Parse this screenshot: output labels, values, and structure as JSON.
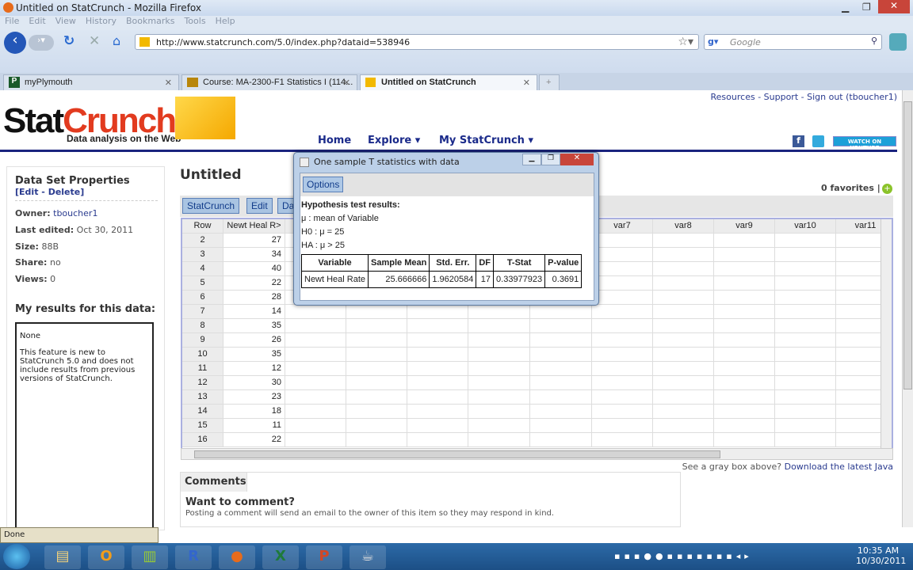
{
  "browser": {
    "title": "Untitled on StatCrunch - Mozilla Firefox",
    "menu": [
      "File",
      "Edit",
      "View",
      "History",
      "Bookmarks",
      "Tools",
      "Help"
    ],
    "url": "http://www.statcrunch.com/5.0/index.php?dataid=538946",
    "search_placeholder": "Google",
    "tabs": [
      {
        "label": "myPlymouth"
      },
      {
        "label": "Course: MA-2300-F1 Statistics I (114..."
      },
      {
        "label": "Untitled on StatCrunch"
      }
    ],
    "status": "Done"
  },
  "site": {
    "logo": "StatCrunch",
    "logo_red": "Crunch",
    "logo_dark": "Stat",
    "tagline": "Data analysis on the Web",
    "nav": [
      "Home",
      "Explore ▾",
      "My StatCrunch ▾"
    ],
    "top_links": "Resources - Support - Sign out (tboucher1)",
    "youtube": "WATCH ON YOUTUBE",
    "brand_color": "#1a237e"
  },
  "sidebar": {
    "title": "Data Set Properties",
    "edit": "Edit",
    "delete": "Delete",
    "props": [
      {
        "label": "Owner:",
        "value": "tboucher1"
      },
      {
        "label": "Last edited:",
        "value": "Oct 30, 2011"
      },
      {
        "label": "Size:",
        "value": "88B"
      },
      {
        "label": "Share:",
        "value": "no"
      },
      {
        "label": "Views:",
        "value": "0"
      }
    ],
    "results_title": "My results for this data:",
    "results_none": "None",
    "results_note": "This feature is new to StatCrunch 5.0 and does not include results from previous versions of StatCrunch."
  },
  "main": {
    "title": "Untitled",
    "favorites": "0 favorites |",
    "toolbar": [
      "StatCrunch",
      "Edit",
      "Da"
    ],
    "grid": {
      "row_header": "Row",
      "columns": [
        "Newt Heal R>",
        "",
        "",
        "",
        "",
        "",
        "var7",
        "var8",
        "var9",
        "var10",
        "var11"
      ],
      "rows": [
        [
          "2",
          "27"
        ],
        [
          "3",
          "34"
        ],
        [
          "4",
          "40"
        ],
        [
          "5",
          "22"
        ],
        [
          "6",
          "28"
        ],
        [
          "7",
          "14"
        ],
        [
          "8",
          "35"
        ],
        [
          "9",
          "26"
        ],
        [
          "10",
          "35"
        ],
        [
          "11",
          "12"
        ],
        [
          "12",
          "30"
        ],
        [
          "13",
          "23"
        ],
        [
          "14",
          "18"
        ],
        [
          "15",
          "11"
        ],
        [
          "16",
          "22"
        ]
      ]
    },
    "java_note": "See a gray box above?",
    "java_link": "Download the latest Java",
    "comments_tab": "Comments",
    "comments_title": "Want to comment?",
    "comments_text": "Posting a comment will send an email to the owner of this item so they may respond in kind."
  },
  "dialog": {
    "title": "One sample T statistics with data",
    "options": "Options",
    "heading": "Hypothesis test results:",
    "mu_line": "μ : mean of Variable",
    "h0": "H0 : μ = 25",
    "ha": "HA : μ > 25",
    "table": {
      "headers": [
        "Variable",
        "Sample Mean",
        "Std. Err.",
        "DF",
        "T-Stat",
        "P-value"
      ],
      "row": [
        "Newt Heal Rate",
        "25.666666",
        "1.9620584",
        "17",
        "0.33977923",
        "0.3691"
      ]
    }
  },
  "taskbar": {
    "apps": [
      "explorer",
      "outlook",
      "project",
      "R",
      "firefox",
      "excel",
      "powerpoint",
      "java"
    ],
    "time": "10:35 AM",
    "date": "10/30/2011"
  }
}
